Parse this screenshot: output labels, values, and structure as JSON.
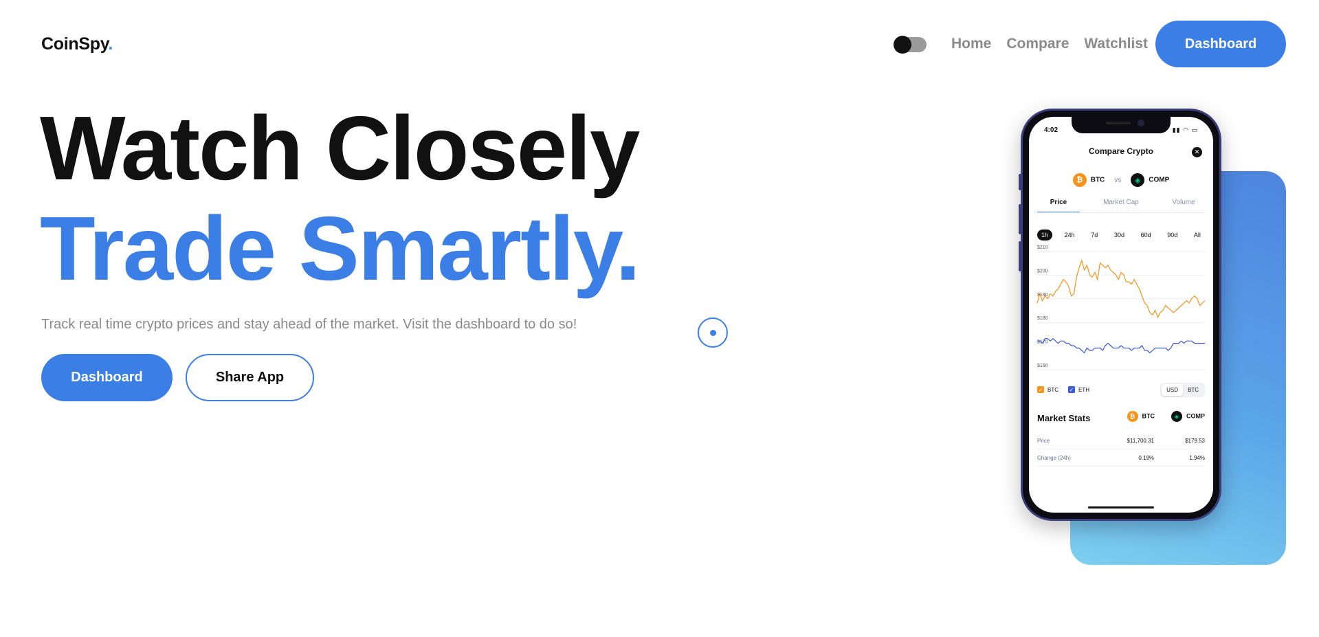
{
  "nav": {
    "logo": "CoinSpy",
    "logo_dot": ".",
    "links": [
      "Home",
      "Compare",
      "Watchlist"
    ],
    "cta": "Dashboard"
  },
  "hero": {
    "line1": "Watch Closely",
    "line2": "Trade Smartly.",
    "subtitle": "Track real time crypto prices and stay ahead of the market. Visit the dashboard to do so!",
    "primary_button": "Dashboard",
    "secondary_button": "Share App"
  },
  "phone": {
    "time": "4:02",
    "status_icons": "▮▮ ◠ ▭",
    "title": "Compare Crypto",
    "close": "✕",
    "coin_a": "BTC",
    "coin_a_symbol": "₿",
    "vs": "vs",
    "coin_b": "COMP",
    "coin_b_symbol": "◈",
    "tabs": [
      "Price",
      "Market Cap",
      "Volume"
    ],
    "active_tab": "Price",
    "ranges": [
      "1h",
      "24h",
      "7d",
      "30d",
      "60d",
      "90d",
      "All"
    ],
    "active_range": "1h",
    "legend": [
      {
        "label": "BTC",
        "color": "#f7931a"
      },
      {
        "label": "ETH",
        "color": "#3b5bdb"
      }
    ],
    "currency": [
      "USD",
      "BTC"
    ],
    "active_currency": "USD",
    "stats_title": "Market Stats",
    "stats_rows": [
      {
        "label": "Price",
        "a": "$11,700.31",
        "b": "$179.53"
      },
      {
        "label": "Change (24h)",
        "a": "0.19%",
        "b": "1.94%"
      }
    ]
  },
  "chart_data": {
    "type": "line",
    "yticks": [
      "$210",
      "$200",
      "$190",
      "$180",
      "$170",
      "$160"
    ],
    "ylim": [
      160,
      210
    ],
    "grid": true,
    "series": [
      {
        "name": "BTC",
        "color": "#f7931a",
        "values": [
          187,
          191,
          188,
          190,
          189,
          191,
          190,
          192,
          193,
          195,
          197,
          196,
          194,
          190,
          191,
          198,
          202,
          205,
          201,
          203,
          199,
          198,
          200,
          197,
          204,
          203,
          202,
          203,
          201,
          200,
          199,
          197,
          200,
          199,
          196,
          196,
          195,
          197,
          195,
          193,
          190,
          187,
          186,
          183,
          182,
          184,
          181,
          183,
          184,
          186,
          185,
          184,
          183,
          184,
          185,
          186,
          187,
          188,
          187,
          189,
          190,
          189,
          186,
          187,
          188
        ]
      },
      {
        "name": "ETH",
        "color": "#3b5bdb",
        "values": [
          171,
          171,
          170,
          172,
          172,
          171,
          172,
          171,
          170,
          171,
          171,
          170,
          170,
          169,
          169,
          168,
          168,
          167,
          166,
          168,
          167,
          167,
          168,
          168,
          168,
          167,
          169,
          170,
          169,
          168,
          168,
          168,
          169,
          168,
          168,
          168,
          167,
          168,
          168,
          168,
          169,
          167,
          167,
          166,
          167,
          168,
          168,
          168,
          168,
          168,
          167,
          168,
          170,
          170,
          170,
          171,
          170,
          171,
          171,
          171,
          170,
          170,
          170,
          170,
          170
        ]
      }
    ]
  }
}
